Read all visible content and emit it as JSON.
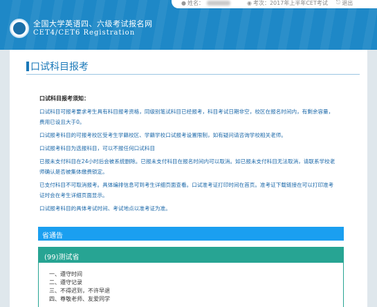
{
  "header": {
    "title": "全国大学英语四、六级考试报名网",
    "subtitle": "CET4/CET6  Registration",
    "brand_color": "#1e88c7"
  },
  "userbar": {
    "name_label": "姓名：",
    "exam_label": "考次：2017年上半年CET考试",
    "logout_label": "退出",
    "icons": [
      "user-icon",
      "exam-icon",
      "logout-icon"
    ]
  },
  "page": {
    "title": "口试科目报考"
  },
  "notice": {
    "heading": "口试科目报考须知：",
    "lines": [
      "口试科目可报考要求考生具有科目报考资格，同级别笔试科目已经报考，科目考试日期非空，校区在报名时间内，有剩余容量，",
      "费用已设且大于0。",
      "口试报考科目的可报考校区受考生学籍校区、学籍学校口试报考设置限制，如有疑问请咨询学校相关老师。",
      "口试报考科目为选报科目，可以不报任何口试科目",
      "已报未支付科目在24小时后会被系统删除。已报未支付科目在报名时间内可以取消。如已报未支付科目无法取消，请联系学校老",
      "师确认是否被集体缴费锁定。",
      "已支付科目不可取消报考。具体编排信息可到考生详细页面查看。口试准考证打印时间在首页。准考证下载链接在可以打印准考",
      "证时会在考生详细页面显示。",
      "口试报考科目的具体考试时间、考试地点以准考证为准。"
    ]
  },
  "province_bar": {
    "label": "省通告"
  },
  "site_box": {
    "header": "(99)测试省",
    "rules": [
      "一、遵守时间",
      "二、遵守记录",
      "三、不得迟到，不许早退",
      "四、尊敬老师、友爱同学"
    ]
  },
  "colors": {
    "accent_blue": "#1a78b8",
    "notice_text": "#1a67a8",
    "province_bar": "#1a9ff0",
    "site_box_teal": "#27a493",
    "page_bg": "#dfe7ec"
  }
}
